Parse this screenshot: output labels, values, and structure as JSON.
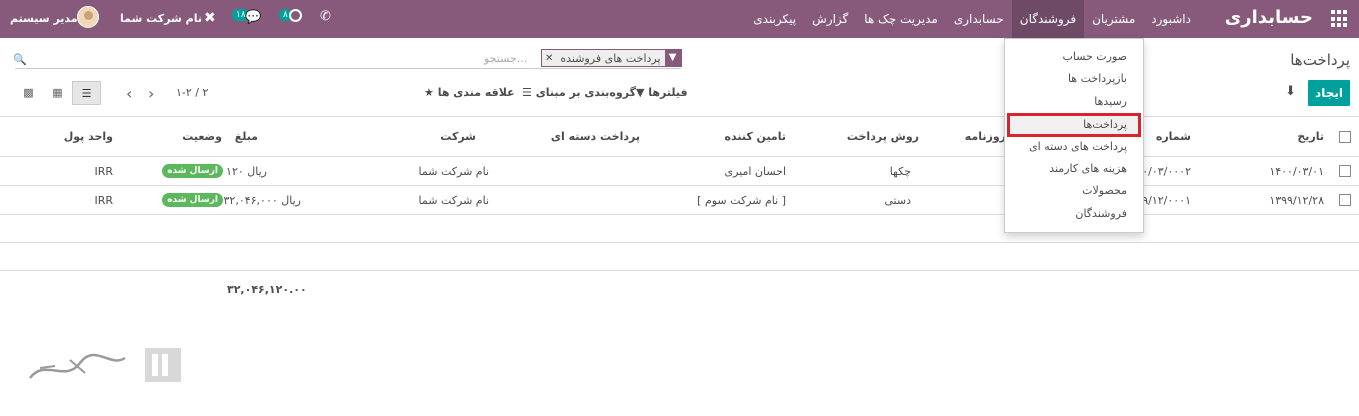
{
  "navbar": {
    "brand": "حسابداری",
    "menu": [
      "داشبورد",
      "مشتریان",
      "فروشندگان",
      "حسابداری",
      "مدیریت چک ها",
      "گزارش",
      "پیکربندی"
    ],
    "active_menu": "فروشندگان",
    "user_name": "مدیر سیستم",
    "company": "نام شرکت شما",
    "chat_count": "۱۸",
    "activity_count": "۸"
  },
  "page": {
    "title": "پرداخت‌ها",
    "create_label": "ایجاد"
  },
  "search": {
    "placeholder": "جستجو...",
    "facet_label": "پرداخت های فروشنده"
  },
  "toolbar": {
    "filters_label": "فیلترها",
    "groupby_label": "گروه‌بندی بر مبنای",
    "favorites_label": "علاقه مندی ها",
    "pager": "۱-۲ / ۲"
  },
  "table": {
    "columns": [
      "تاریخ",
      "شماره",
      "روزنامه",
      "روش پرداخت",
      "تامین کننده",
      "پرداخت دسته ای",
      "شرکت",
      "مبلغ",
      "وضعیت",
      "واحد پول"
    ],
    "rows": [
      {
        "date": "۱۴۰۰/۰۳/۰۱",
        "number": "۱۴۰۰/۰۳/۰۰۰۲",
        "method": "چکها",
        "partner": "احسان امیری",
        "batch": "",
        "company": "نام شرکت شما",
        "amount": "۱۲۰ ریال",
        "status": "ارسال شده",
        "currency": "IRR"
      },
      {
        "date": "۱۳۹۹/۱۲/۲۸",
        "number": "۱۳۹۹/۱۲/۰۰۰۱",
        "method": "دستی",
        "partner": "[ نام شرکت سوم ]",
        "batch": "",
        "company": "نام شرکت شما",
        "amount": "۳۲,۰۴۶,۰۰۰ ریال",
        "status": "ارسال شده",
        "currency": "IRR"
      }
    ],
    "total": "۳۲,۰۴۶,۱۲۰.۰۰"
  },
  "dropdown": {
    "items": [
      "صورت حساب",
      "بازپرداخت ها",
      "رسیدها",
      "پرداخت‌ها",
      "پرداخت های دسته ای",
      "هزینه های کارمند",
      "محصولات",
      "فروشندگان"
    ],
    "highlighted": "پرداخت‌ها"
  },
  "colors": {
    "navbar": "#875a7b",
    "primary": "#00a09d",
    "badge": "#5cb85c",
    "highlight_border": "#d9232d"
  }
}
